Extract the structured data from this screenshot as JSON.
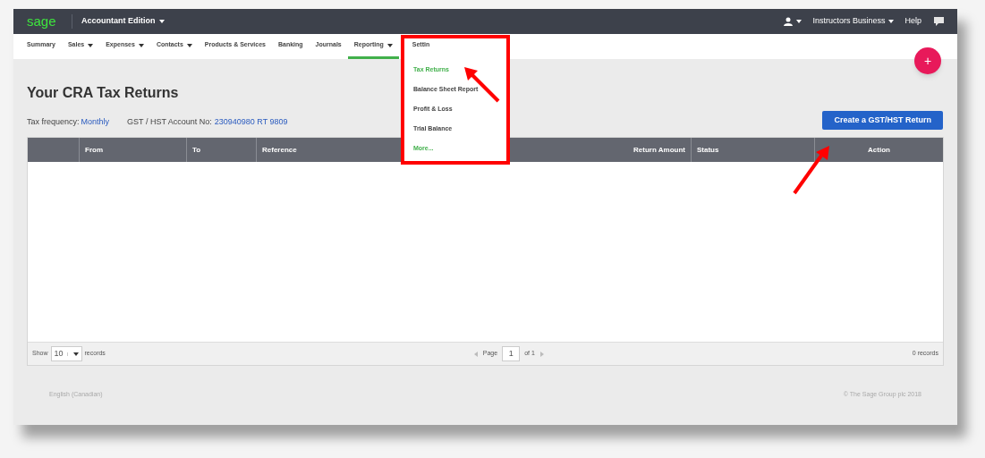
{
  "topbar": {
    "logo": "sage",
    "edition": "Accountant Edition",
    "business": "Instructors Business",
    "help": "Help"
  },
  "nav": [
    {
      "label": "Summary",
      "caret": false,
      "selected": false
    },
    {
      "label": "Sales",
      "caret": true,
      "selected": false
    },
    {
      "label": "Expenses",
      "caret": true,
      "selected": false
    },
    {
      "label": "Contacts",
      "caret": true,
      "selected": false
    },
    {
      "label": "Products & Services",
      "caret": false,
      "selected": false
    },
    {
      "label": "Banking",
      "caret": false,
      "selected": false
    },
    {
      "label": "Journals",
      "caret": false,
      "selected": false
    },
    {
      "label": "Reporting",
      "caret": true,
      "selected": true
    },
    {
      "label": "Settin",
      "caret": false,
      "selected": false
    }
  ],
  "dropdown": [
    {
      "label": "Tax Returns",
      "selected": true,
      "kind": "item"
    },
    {
      "label": "Balance Sheet Report",
      "selected": false,
      "kind": "item"
    },
    {
      "label": "Profit & Loss",
      "selected": false,
      "kind": "item"
    },
    {
      "label": "Trial Balance",
      "selected": false,
      "kind": "item"
    },
    {
      "label": "More...",
      "kind": "link"
    }
  ],
  "fab": "+",
  "title": "Your CRA Tax Returns",
  "info": {
    "frequency_label": "Tax frequency:",
    "frequency_value": "Monthly",
    "account_label": "GST / HST Account No:",
    "account_value": "230940980 RT 9809"
  },
  "create_button": "Create a GST/HST Return",
  "table": {
    "columns": [
      {
        "label": "From"
      },
      {
        "label": "To"
      },
      {
        "label": "Reference"
      },
      {
        "label": "Return Amount"
      },
      {
        "label": "Status"
      },
      {
        "label": "Action"
      }
    ]
  },
  "pager": {
    "show": "Show",
    "page_size": "10",
    "records": "records",
    "page": "Page",
    "page_number": "1",
    "of": "of 1",
    "total": "0 records"
  },
  "footer": {
    "language": "English (Canadian)",
    "copyright": "© The Sage Group plc 2018"
  }
}
